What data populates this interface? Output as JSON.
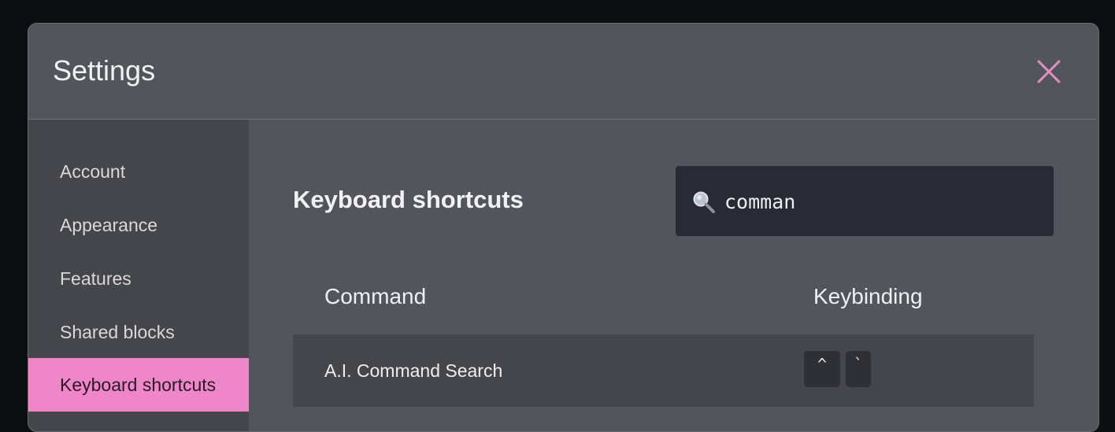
{
  "dialog": {
    "title": "Settings"
  },
  "sidebar": {
    "items": [
      {
        "label": "Account",
        "active": false
      },
      {
        "label": "Appearance",
        "active": false
      },
      {
        "label": "Features",
        "active": false
      },
      {
        "label": "Shared blocks",
        "active": false
      },
      {
        "label": "Keyboard shortcuts",
        "active": true
      }
    ]
  },
  "main": {
    "section_title": "Keyboard shortcuts",
    "search": {
      "value": "comman",
      "icon": "magnifier-icon"
    },
    "table": {
      "headers": [
        "Command",
        "Keybinding"
      ],
      "rows": [
        {
          "command": "A.I. Command Search",
          "keys": [
            "^",
            "`"
          ]
        }
      ]
    }
  },
  "colors": {
    "accent": "#ee86c9",
    "close_icon": "#e58fc8",
    "dialog_bg": "#52555c",
    "sidebar_bg": "#45464b",
    "search_bg": "#282a35"
  }
}
